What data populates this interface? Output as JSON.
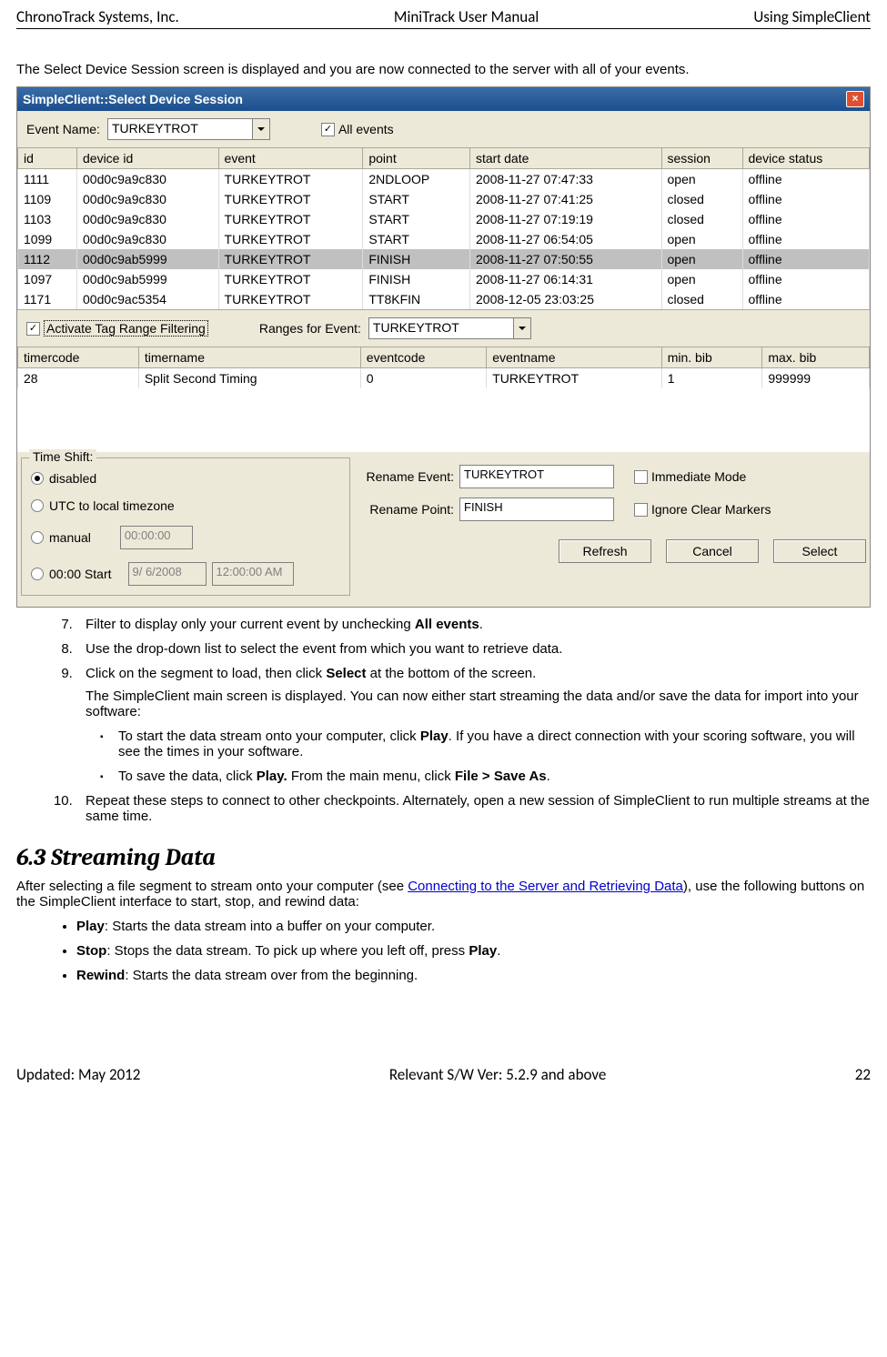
{
  "header": {
    "left": "ChronoTrack Systems, Inc.",
    "center": "MiniTrack User Manual",
    "right": "Using SimpleClient"
  },
  "footer": {
    "left": "Updated: May 2012",
    "center": "Relevant S/W Ver: 5.2.9 and above",
    "right": "22"
  },
  "intro": "The Select Device Session screen is displayed and you are now connected to the server with all of your events.",
  "win": {
    "title": "SimpleClient::Select Device Session",
    "eventNameLabel": "Event Name:",
    "eventNameValue": "TURKEYTROT",
    "allEventsLabel": "All events",
    "table1Headers": [
      "id",
      "device id",
      "event",
      "point",
      "start date",
      "session",
      "device status"
    ],
    "table1Rows": [
      [
        "1111",
        "00d0c9a9c830",
        "TURKEYTROT",
        "2NDLOOP",
        "2008-11-27 07:47:33",
        "open",
        "offline"
      ],
      [
        "1109",
        "00d0c9a9c830",
        "TURKEYTROT",
        "START",
        "2008-11-27 07:41:25",
        "closed",
        "offline"
      ],
      [
        "1103",
        "00d0c9a9c830",
        "TURKEYTROT",
        "START",
        "2008-11-27 07:19:19",
        "closed",
        "offline"
      ],
      [
        "1099",
        "00d0c9a9c830",
        "TURKEYTROT",
        "START",
        "2008-11-27 06:54:05",
        "open",
        "offline"
      ],
      [
        "1112",
        "00d0c9ab5999",
        "TURKEYTROT",
        "FINISH",
        "2008-11-27 07:50:55",
        "open",
        "offline"
      ],
      [
        "1097",
        "00d0c9ab5999",
        "TURKEYTROT",
        "FINISH",
        "2008-11-27 06:14:31",
        "open",
        "offline"
      ],
      [
        "1171",
        "00d0c9ac5354",
        "TURKEYTROT",
        "TT8KFIN",
        "2008-12-05 23:03:25",
        "closed",
        "offline"
      ]
    ],
    "selectedRowIndex": 4,
    "activateLabel": "Activate Tag Range Filtering",
    "rangesLabel": "Ranges for Event:",
    "rangesValue": "TURKEYTROT",
    "table2Headers": [
      "timercode",
      "timername",
      "eventcode",
      "eventname",
      "min. bib",
      "max. bib"
    ],
    "table2Row": [
      "28",
      "Split Second Timing",
      "0",
      "TURKEYTROT",
      "1",
      "999999"
    ],
    "timeShiftLabel": "Time Shift:",
    "tsDisabled": "disabled",
    "tsUtc": "UTC to local timezone",
    "tsManual": "manual",
    "tsManualTime": "00:00:00",
    "tsStart": "00:00 Start",
    "tsStartDate": "9/ 6/2008",
    "tsStartTime": "12:00:00 AM",
    "renameEventLabel": "Rename Event:",
    "renameEventValue": "TURKEYTROT",
    "renamePointLabel": "Rename Point:",
    "renamePointValue": "FINISH",
    "immediateLabel": "Immediate Mode",
    "ignoreLabel": "Ignore Clear Markers",
    "btnRefresh": "Refresh",
    "btnCancel": "Cancel",
    "btnSelect": "Select"
  },
  "steps": {
    "s7a": "Filter to display only your current event by unchecking ",
    "s7b": "All events",
    "s7c": ".",
    "s8": "Use the drop-down list to select the event from which you want to retrieve data.",
    "s9a": "Click on the segment to load, then click ",
    "s9b": "Select",
    "s9c": " at the bottom of the screen.",
    "s9d": "The SimpleClient main screen is displayed. You can now either start streaming the data and/or save the data for import into your software:",
    "s9e1a": "To start the data stream onto your computer, click ",
    "s9e1b": "Play",
    "s9e1c": ". If you have a direct connection with your scoring software, you will see the times in your software.",
    "s9e2a": "To save the data, click ",
    "s9e2b": "Play.",
    "s9e2c": " From the main menu, click ",
    "s9e2d": "File > Save As",
    "s9e2e": ".",
    "s10": "Repeat these steps to connect to other checkpoints. Alternately, open a new session of SimpleClient to run multiple streams at the same time."
  },
  "section63": {
    "title": "6.3    Streaming Data",
    "introA": "After selecting a file segment to stream onto your computer (see ",
    "link": "Connecting to the Server and Retrieving Data",
    "introB": "), use the following buttons on the SimpleClient interface to start, stop, and rewind data:",
    "b1a": "Play",
    "b1b": ": Starts the data stream into a buffer on your computer.",
    "b2a": "Stop",
    "b2b": ": Stops the data stream. To pick up where you left off, press ",
    "b2c": "Play",
    "b2d": ".",
    "b3a": "Rewind",
    "b3b": ": Starts the data stream over from the beginning."
  }
}
